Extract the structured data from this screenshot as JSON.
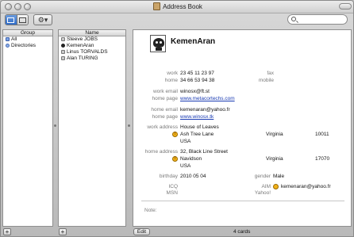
{
  "window": {
    "title": "Address Book"
  },
  "toolbar": {
    "action_label": "⚙▾"
  },
  "groups": {
    "header": "Group",
    "items": [
      {
        "label": "All"
      },
      {
        "label": "Directories"
      }
    ]
  },
  "names": {
    "header": "Name",
    "items": [
      {
        "label": "Steeve JOBS"
      },
      {
        "label": "KemenAran"
      },
      {
        "label": "Linus TORVALDS"
      },
      {
        "label": "Alan TURING"
      }
    ]
  },
  "card": {
    "name": "KemenAran",
    "labels": {
      "work_phone": "work",
      "home_phone": "home",
      "fax": "fax",
      "mobile": "mobile",
      "work_email": "work email",
      "home_page_1": "home page",
      "home_email": "home email",
      "home_page_2": "home page",
      "work_address": "work address",
      "home_address": "home address",
      "birthday": "birthday",
      "gender": "gender",
      "icq": "ICQ",
      "aim": "AIM",
      "msn": "MSN",
      "yahoo": "Yahoo!",
      "note": "Note:"
    },
    "work_phone": "23 45 11 23 97",
    "home_phone": "34 66 53 94 38",
    "work_email": "winosx@ft.st",
    "home_page_1": "www.metacortechs.com",
    "home_email": "kemenaran@yahoo.fr",
    "home_page_2": "www.winosx.tk",
    "work_address": {
      "line1": "House of Leaves",
      "line2": "Ash Tree Lane",
      "country": "USA",
      "state": "Virginia",
      "zip": "10011"
    },
    "home_address": {
      "line1": "32, Black Line Street",
      "line2": "Navidson",
      "country": "USA",
      "state": "Virginia",
      "zip": "17070"
    },
    "birthday": "2010 05 04",
    "gender": "Male",
    "aim": "kemenaran@yahoo.fr"
  },
  "bottom": {
    "plus": "+",
    "edit_label": "Edit",
    "count": "4 cards"
  },
  "colors": {
    "selection": "#3b6cd1",
    "link": "#1a3bb3",
    "label_gray": "#7a7a7a"
  }
}
